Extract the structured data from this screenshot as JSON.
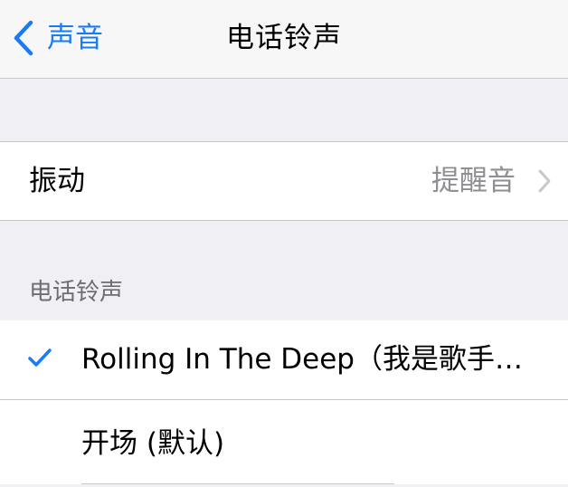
{
  "nav": {
    "back_label": "声音",
    "title": "电话铃声"
  },
  "vibration": {
    "label": "振动",
    "value": "提醒音"
  },
  "ringtones": {
    "section_header": "电话铃声",
    "items": [
      {
        "label": "Rolling In The Deep（我是歌手…",
        "selected": true
      },
      {
        "label": "开场 (默认)",
        "selected": false
      }
    ]
  },
  "colors": {
    "accent": "#1a7cf5",
    "background": "#efeff4",
    "secondary_text": "#8e8e93"
  }
}
